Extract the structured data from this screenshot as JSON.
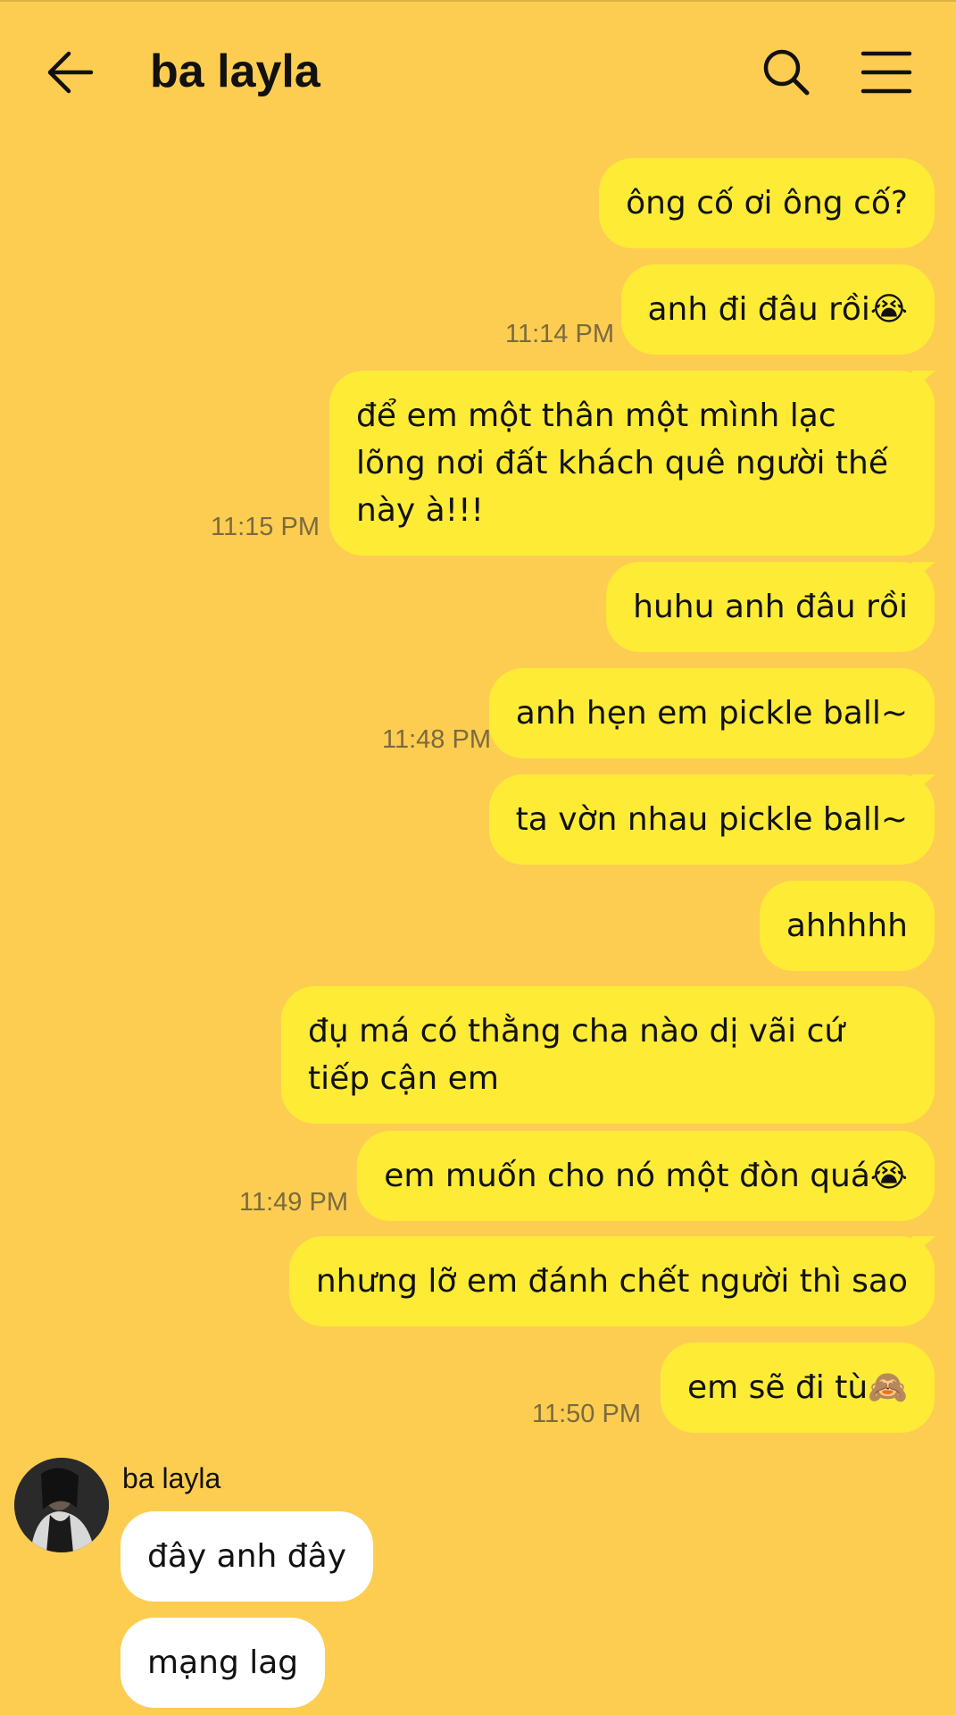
{
  "header": {
    "title": "ba layla",
    "back_icon": "arrow-left-icon",
    "search_icon": "search-icon",
    "menu_icon": "hamburger-menu-icon"
  },
  "colors": {
    "background": "#fdcd52",
    "my_bubble": "#fdeb36",
    "other_bubble": "#ffffff",
    "timestamp": "#7a6a3e"
  },
  "messages": {
    "m1": "ông cố ơi ông cố?",
    "m2": "anh đi đâu rồi😭",
    "m2_time": "11:14 PM",
    "m3": "để em một thân một mình lạc lõng nơi đất khách quê người thế này à!!!",
    "m3_time": "11:15 PM",
    "m4": "huhu anh đâu rồi",
    "m5": "anh hẹn em pickle ball~",
    "m5_time": "11:48 PM",
    "m6": "ta vờn nhau pickle ball~",
    "m7": "ahhhhh",
    "m8": "đụ má có thằng cha nào dị vãi cứ tiếp cận em",
    "m9": "em muốn cho nó một đòn quá😭",
    "m9_time": "11:49 PM",
    "m10": "nhưng lỡ em đánh chết người thì sao",
    "m11": "em sẽ đi tù🙈",
    "m11_time": "11:50 PM"
  },
  "incoming": {
    "sender_name": "ba layla",
    "m1": "đây anh đây",
    "m2": "mạng lag"
  }
}
